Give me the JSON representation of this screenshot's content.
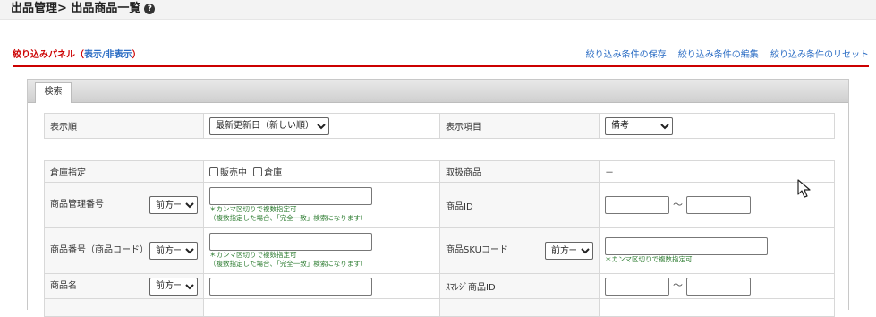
{
  "header": {
    "title": "出品管理> 出品商品一覧",
    "help_icon": "?"
  },
  "panel": {
    "label": "絞り込みパネル（",
    "toggle": "表示/非表示",
    "label_end": "）",
    "links": [
      "絞り込み条件の保存",
      "絞り込み条件の編集",
      "絞り込み条件のリセット"
    ]
  },
  "tabs": [
    "検索"
  ],
  "sort": {
    "label": "表示順",
    "selected": "最新更新日（新しい順）",
    "display_label": "表示項目",
    "display_selected": "備考"
  },
  "filters": {
    "warehouse": {
      "label": "倉庫指定",
      "options": [
        "販売中",
        "倉庫"
      ]
    },
    "handling": {
      "label": "取扱商品",
      "value": "－"
    },
    "mgmt_no": {
      "label": "商品管理番号",
      "match": "前方一致",
      "note1": "＊カンマ区切りで複数指定可",
      "note2": "（複数指定した場合、「完全一致」検索になります）"
    },
    "product_id": {
      "label": "商品ID",
      "tilde": "～"
    },
    "product_code": {
      "label": "商品番号（商品コード）",
      "match": "前方一致",
      "note1": "＊カンマ区切りで複数指定可",
      "note2": "（複数指定した場合、「完全一致」検索になります）"
    },
    "sku_code": {
      "label": "商品SKUコード",
      "match": "前方一致",
      "note": "＊カンマ区切りで複数指定可"
    },
    "product_name": {
      "label": "商品名",
      "match": "前方一致"
    },
    "smaregi_id": {
      "label": "ｽﾏﾚｼﾞ商品ID",
      "tilde": "～"
    }
  },
  "colors": {
    "accent_red": "#cc0000",
    "link_blue": "#2a6cc4",
    "note_green": "#2e7d32"
  }
}
